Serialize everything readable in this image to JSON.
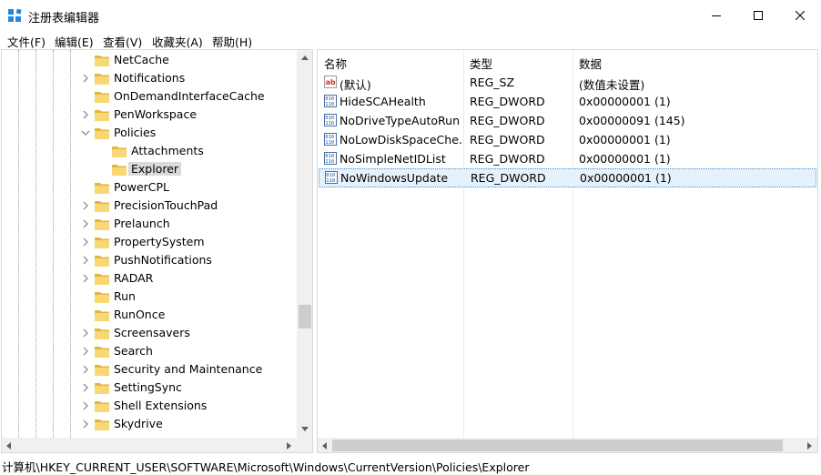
{
  "window": {
    "title": "注册表编辑器"
  },
  "menu": [
    "文件(F)",
    "编辑(E)",
    "查看(V)",
    "收藏夹(A)",
    "帮助(H)"
  ],
  "tree": [
    {
      "label": "NetCache",
      "chevron": "",
      "selected": false
    },
    {
      "label": "Notifications",
      "chevron": "right",
      "selected": false
    },
    {
      "label": "OnDemandInterfaceCache",
      "chevron": "",
      "selected": false
    },
    {
      "label": "PenWorkspace",
      "chevron": "right",
      "selected": false
    },
    {
      "label": "Policies",
      "chevron": "down",
      "selected": false
    },
    {
      "label": "Attachments",
      "chevron": "",
      "selected": false
    },
    {
      "label": "Explorer",
      "chevron": "",
      "selected": true
    },
    {
      "label": "PowerCPL",
      "chevron": "",
      "selected": false
    },
    {
      "label": "PrecisionTouchPad",
      "chevron": "right",
      "selected": false
    },
    {
      "label": "Prelaunch",
      "chevron": "right",
      "selected": false
    },
    {
      "label": "PropertySystem",
      "chevron": "right",
      "selected": false
    },
    {
      "label": "PushNotifications",
      "chevron": "right",
      "selected": false
    },
    {
      "label": "RADAR",
      "chevron": "right",
      "selected": false
    },
    {
      "label": "Run",
      "chevron": "",
      "selected": false
    },
    {
      "label": "RunOnce",
      "chevron": "",
      "selected": false
    },
    {
      "label": "Screensavers",
      "chevron": "right",
      "selected": false
    },
    {
      "label": "Search",
      "chevron": "right",
      "selected": false
    },
    {
      "label": "Security and Maintenance",
      "chevron": "right",
      "selected": false
    },
    {
      "label": "SettingSync",
      "chevron": "right",
      "selected": false
    },
    {
      "label": "Shell Extensions",
      "chevron": "right",
      "selected": false
    },
    {
      "label": "Skydrive",
      "chevron": "right",
      "selected": false
    }
  ],
  "list": {
    "columns": [
      "名称",
      "类型",
      "数据"
    ],
    "rows": [
      {
        "icon": "string-value-icon",
        "name": "(默认)",
        "type": "REG_SZ",
        "data": "(数值未设置)",
        "selected": false
      },
      {
        "icon": "binary-value-icon",
        "name": "HideSCAHealth",
        "type": "REG_DWORD",
        "data": "0x00000001 (1)",
        "selected": false
      },
      {
        "icon": "binary-value-icon",
        "name": "NoDriveTypeAutoRun",
        "type": "REG_DWORD",
        "data": "0x00000091 (145)",
        "selected": false
      },
      {
        "icon": "binary-value-icon",
        "name": "NoLowDiskSpaceChe...",
        "type": "REG_DWORD",
        "data": "0x00000001 (1)",
        "selected": false
      },
      {
        "icon": "binary-value-icon",
        "name": "NoSimpleNetIDList",
        "type": "REG_DWORD",
        "data": "0x00000001 (1)",
        "selected": false
      },
      {
        "icon": "binary-value-icon",
        "name": "NoWindowsUpdate",
        "type": "REG_DWORD",
        "data": "0x00000001 (1)",
        "selected": true
      }
    ]
  },
  "status": {
    "path": "计算机\\HKEY_CURRENT_USER\\SOFTWARE\\Microsoft\\Windows\\CurrentVersion\\Policies\\Explorer"
  },
  "colors": {
    "folder": "#f8d775",
    "folder_dark": "#e2b53f",
    "selection": "#e5f1fb",
    "tree_selection": "#d9d9d9",
    "scrollbar": "#f0f0f0"
  }
}
